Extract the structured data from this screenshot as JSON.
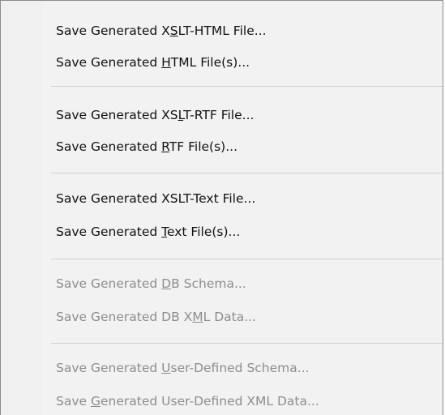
{
  "menu": {
    "items": [
      {
        "pre": "Save Generated X",
        "key": "S",
        "post": "LT-HTML File...",
        "enabled": true
      },
      {
        "pre": "Save Generated ",
        "key": "H",
        "post": "TML File(s)...",
        "enabled": true
      },
      {
        "pre": "Save Generated XS",
        "key": "L",
        "post": "T-RTF File...",
        "enabled": true
      },
      {
        "pre": "Save Generated ",
        "key": "R",
        "post": "TF File(s)...",
        "enabled": true
      },
      {
        "pre": "Save Generated XSLT-Text File...",
        "key": "",
        "post": "",
        "enabled": true
      },
      {
        "pre": "Save Generated ",
        "key": "T",
        "post": "ext File(s)...",
        "enabled": true
      },
      {
        "pre": "Save Generated ",
        "key": "D",
        "post": "B Schema...",
        "enabled": false
      },
      {
        "pre": "Save Generated DB X",
        "key": "M",
        "post": "L Data...",
        "enabled": false
      },
      {
        "pre": "Save Generated ",
        "key": "U",
        "post": "ser-Defined Schema...",
        "enabled": false
      },
      {
        "pre": "Save ",
        "key": "G",
        "post": "enerated User-Defined XML Data...",
        "enabled": false
      }
    ]
  }
}
